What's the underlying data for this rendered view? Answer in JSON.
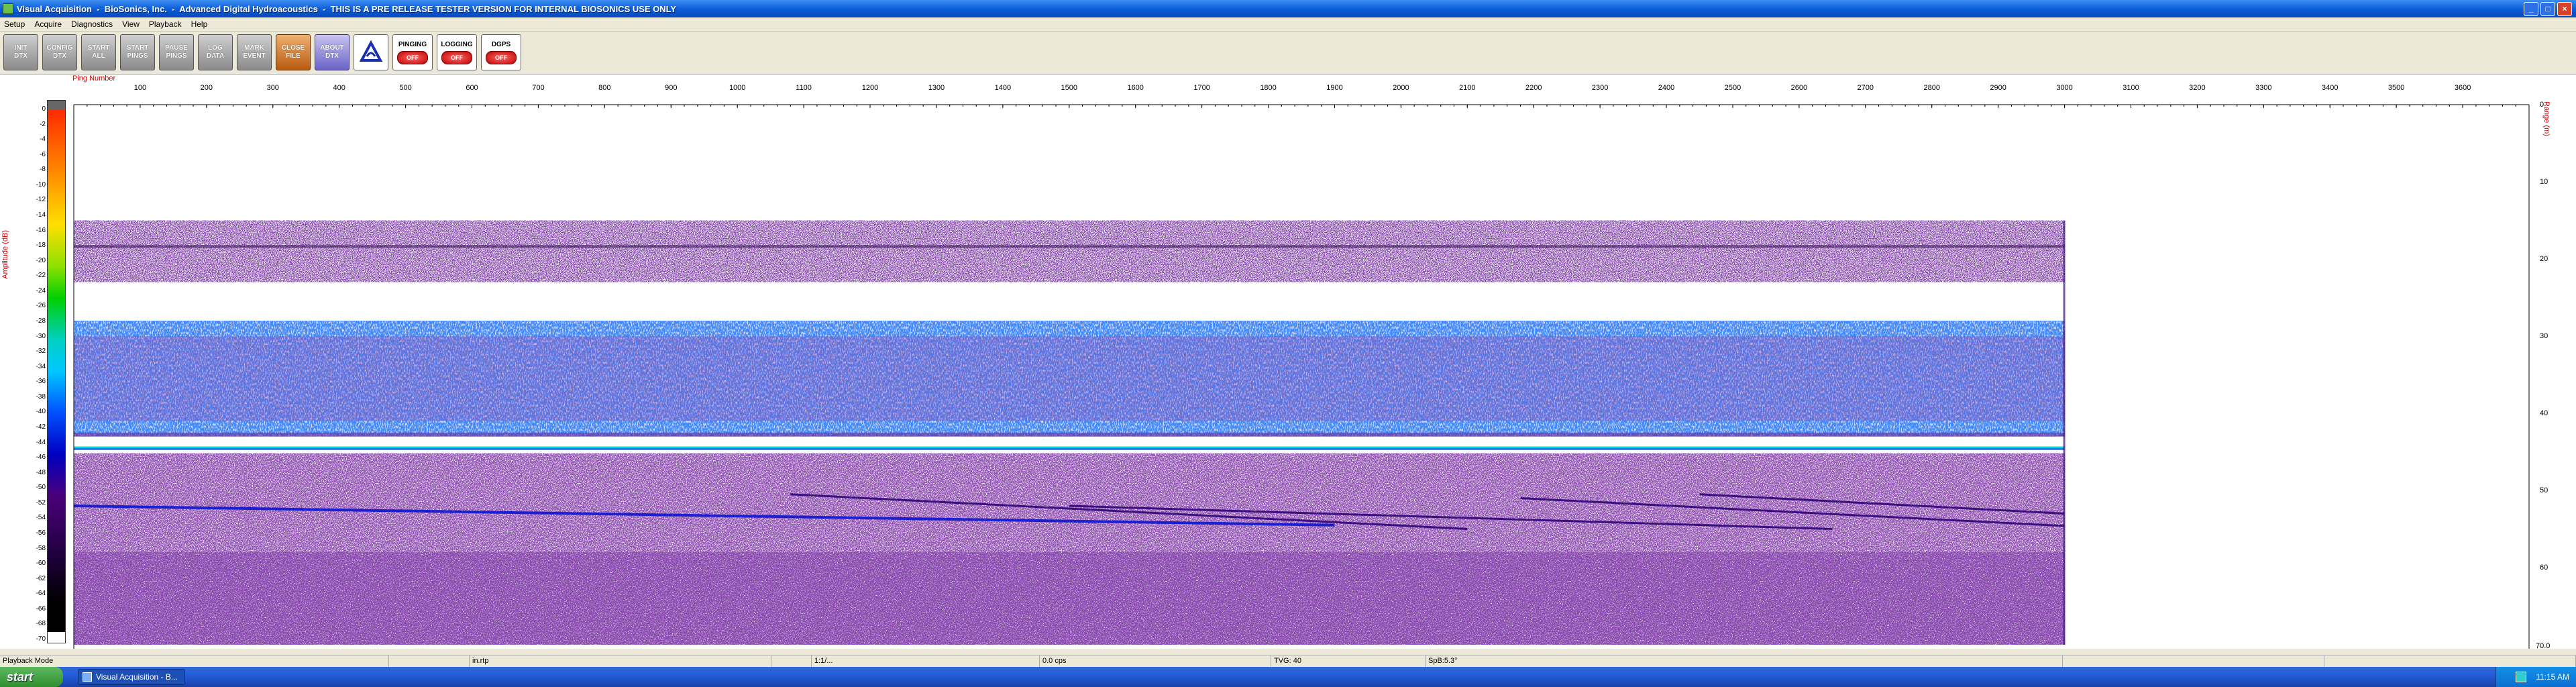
{
  "window": {
    "title": "Visual Acquisition  -  BioSonics, Inc.  -  Advanced Digital Hydroacoustics  -  THIS IS A PRE RELEASE TESTER VERSION FOR INTERNAL BIOSONICS USE ONLY",
    "minimize_label": "_",
    "maximize_label": "□",
    "close_label": "×"
  },
  "menu": [
    "Setup",
    "Acquire",
    "Diagnostics",
    "View",
    "Playback",
    "Help"
  ],
  "toolbar": {
    "buttons": [
      {
        "label": "INIT\nDTX",
        "name": "init-dtx-button"
      },
      {
        "label": "CONFIG\nDTX",
        "name": "config-dtx-button"
      },
      {
        "label": "START\nALL",
        "name": "start-all-button"
      },
      {
        "label": "START\nPINGS",
        "name": "start-pings-button"
      },
      {
        "label": "PAUSE\nPINGS",
        "name": "pause-pings-button"
      },
      {
        "label": "LOG\nDATA",
        "name": "log-data-button"
      },
      {
        "label": "MARK\nEVENT",
        "name": "mark-event-button"
      },
      {
        "label": "CLOSE\nFILE",
        "name": "close-file-button"
      },
      {
        "label": "ABOUT\nDTX",
        "name": "about-dtx-button"
      }
    ],
    "indicators": [
      {
        "label": "PINGING",
        "state": "OFF"
      },
      {
        "label": "LOGGING",
        "state": "OFF"
      },
      {
        "label": "DGPS",
        "state": "OFF"
      }
    ]
  },
  "echogram": {
    "x_axis_label": "Ping Number",
    "amplitude_label": "Amplitude (dB)",
    "range_label": "Range (m)",
    "x_ticks": [
      100,
      200,
      300,
      400,
      500,
      600,
      700,
      800,
      900,
      1000,
      1100,
      1200,
      1300,
      1400,
      1500,
      1600,
      1700,
      1800,
      1900,
      2000,
      2100,
      2200,
      2300,
      2400,
      2500,
      2600,
      2700,
      2800,
      2900,
      3000,
      3100,
      3200,
      3300,
      3400,
      3500,
      3600
    ],
    "x_max": 3700,
    "amp_ticks": [
      0,
      -2,
      -4,
      -6,
      -8,
      -10,
      -12,
      -14,
      -16,
      -18,
      -20,
      -22,
      -24,
      -26,
      -28,
      -30,
      -32,
      -34,
      -36,
      -38,
      -40,
      -42,
      -44,
      -46,
      -48,
      -50,
      -52,
      -54,
      -56,
      -58,
      -60,
      -62,
      -64,
      -66,
      -68,
      -70
    ],
    "range_ticks": [
      0,
      10,
      20,
      30,
      40,
      50,
      60
    ],
    "range_end_label": "70.0",
    "range_max": 70,
    "pings_recorded": 3000
  },
  "statusbar": [
    "Playback Mode",
    "",
    "in.rtp",
    "",
    "1:1/...",
    "0.0 cps",
    "TVG: 40",
    "SpB:5.3°",
    "",
    ""
  ],
  "taskbar": {
    "start_label": "start",
    "task_label": "Visual Acquisition  -  B...",
    "clock": "11:15 AM"
  }
}
